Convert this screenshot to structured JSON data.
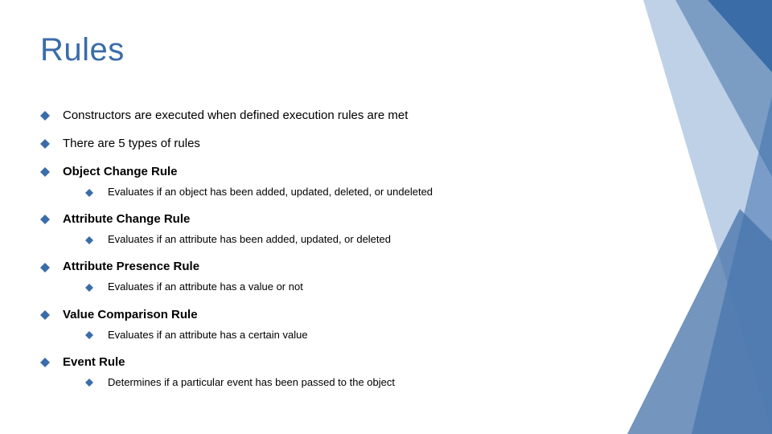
{
  "colors": {
    "title": "#3a6ca8",
    "bullet": "#3a6ca8",
    "deco_dark": "#4472a8",
    "deco_mid": "#6d93c3",
    "deco_light": "#a3bedd"
  },
  "title": "Rules",
  "items": [
    {
      "text": "Constructors are executed when defined execution rules are met",
      "bold": false
    },
    {
      "text": "There are 5 types of rules",
      "bold": false
    },
    {
      "text": "Object Change Rule",
      "bold": true,
      "sub": "Evaluates if an object has been added, updated, deleted, or undeleted"
    },
    {
      "text": "Attribute Change Rule",
      "bold": true,
      "sub": "Evaluates if an attribute has been added, updated, or deleted"
    },
    {
      "text": "Attribute Presence Rule",
      "bold": true,
      "sub": "Evaluates if an attribute has a value or not"
    },
    {
      "text": "Value Comparison Rule",
      "bold": true,
      "sub": "Evaluates if an attribute has a certain value"
    },
    {
      "text": "Event Rule",
      "bold": true,
      "sub": "Determines if a particular event has been passed to the object"
    }
  ]
}
